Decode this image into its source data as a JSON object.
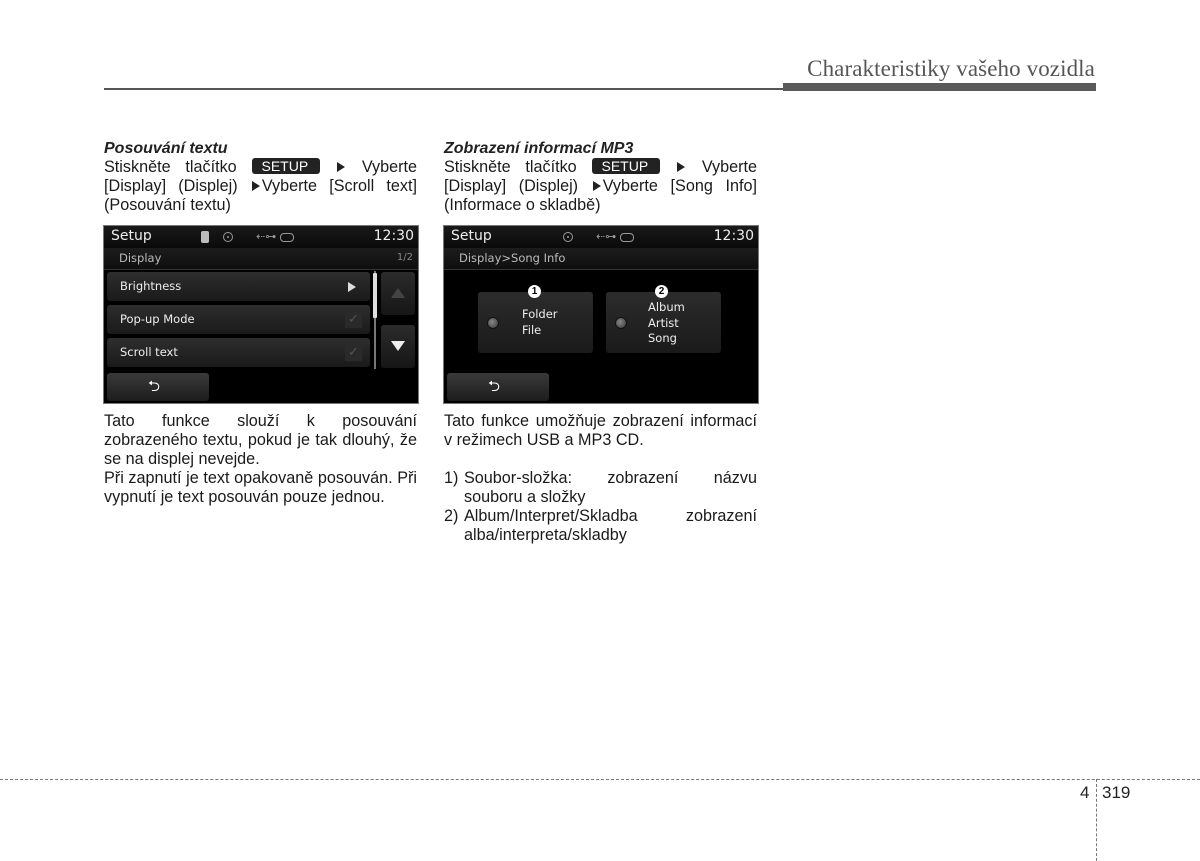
{
  "header": {
    "title": "Charakteristiky vašeho vozidla"
  },
  "left": {
    "section_title": "Posouvání textu",
    "instruction": {
      "line1_pre": "Stiskněte tlačítko",
      "button": "SETUP",
      "line1_post": "Vyberte",
      "line2_pre": "[Display] (Displej)",
      "line2_post": "Vyberte [Scroll text]",
      "line3": "(Posouvání textu)"
    },
    "screen": {
      "title": "Setup",
      "time": "12:30",
      "status_icons": [
        "bluetooth-icon",
        "disc-icon",
        "usb-icon",
        "aux-icon"
      ],
      "subheader": "Display",
      "page_indicator": "1/2",
      "rows": [
        {
          "label": "Brightness",
          "control": "arrow"
        },
        {
          "label": "Pop-up Mode",
          "control": "checkbox"
        },
        {
          "label": "Scroll text",
          "control": "checkbox"
        }
      ],
      "check_glyph": "✓",
      "back_glyph": "⮌"
    },
    "body": [
      "Tato funkce slouží k posouvání zobrazeného textu, pokud je tak dlouhý, že se na displej nevejde.",
      "Při zapnutí je text opakovaně posouván. Při vypnutí je text posouván pouze jednou."
    ]
  },
  "right": {
    "section_title": "Zobrazení informací MP3",
    "instruction": {
      "line1_pre": "Stiskněte tlačítko",
      "button": "SETUP",
      "line1_post": "Vyberte",
      "line2_pre": "[Display] (Displej)",
      "line2_post": "Vyberte [Song Info]",
      "line3": "(Informace o skladbě)"
    },
    "screen": {
      "title": "Setup",
      "time": "12:30",
      "status_icons": [
        "disc-icon",
        "usb-icon",
        "aux-icon"
      ],
      "subheader": "Display>Song Info",
      "options": [
        {
          "badge": "1",
          "lines": [
            "Folder",
            "File"
          ]
        },
        {
          "badge": "2",
          "lines": [
            "Album",
            "Artist",
            "Song"
          ]
        }
      ],
      "back_glyph": "⮌"
    },
    "body": "Tato funkce umožňuje zobrazení informací v režimech USB a MP3 CD.",
    "list": [
      {
        "num": "1)",
        "text": "Soubor-složka: zobrazení názvu souboru a složky"
      },
      {
        "num": "2)",
        "text": "Album/Interpret/Skladba zobrazení alba/interpreta/skladby"
      }
    ]
  },
  "footer": {
    "chapter": "4",
    "page": "319"
  }
}
